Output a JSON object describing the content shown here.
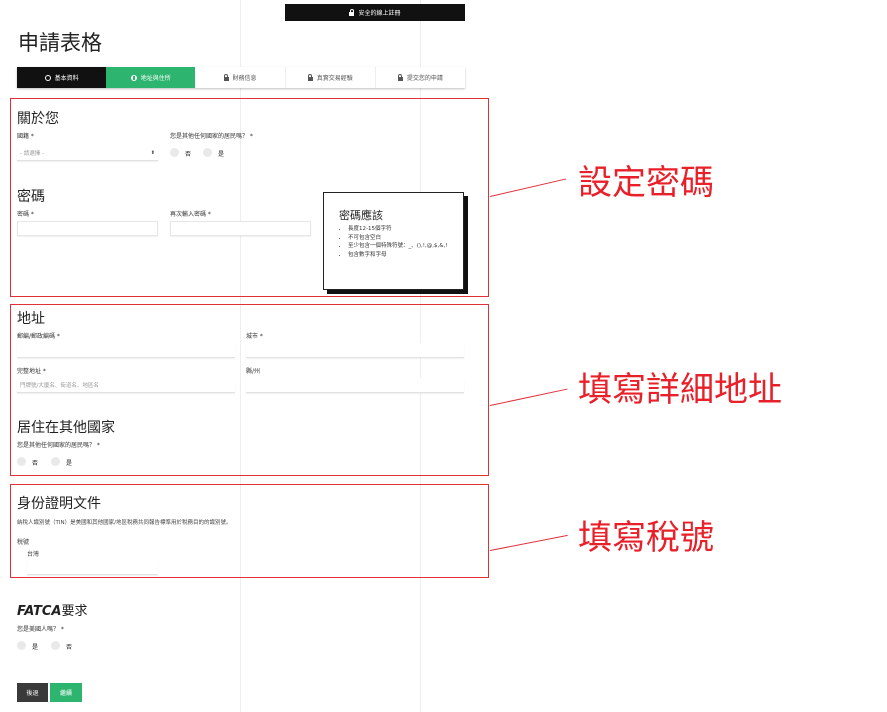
{
  "header": {
    "secure_label": "安全的線上註冊",
    "page_title": "申請表格"
  },
  "steps": [
    {
      "label": "基本資料",
      "state": "done",
      "icon": "check-circle-icon"
    },
    {
      "label": "地址與住所",
      "state": "active",
      "icon": "plus-circle-icon"
    },
    {
      "label": "財務信息",
      "state": "locked",
      "icon": "lock-icon"
    },
    {
      "label": "真實交易經驗",
      "state": "locked",
      "icon": "lock-icon"
    },
    {
      "label": "提交您的申請",
      "state": "locked",
      "icon": "lock-icon"
    }
  ],
  "about": {
    "title": "關於您",
    "nationality_label": "國籍 *",
    "nationality_placeholder": "- 請選擇 -",
    "other_citizen_label": "您是其他任何國家的居民嗎？ *",
    "no": "否",
    "yes": "是"
  },
  "password": {
    "title": "密碼",
    "password_label": "密碼 *",
    "confirm_label": "再次輸入密碼 *",
    "rules_title": "密碼應該",
    "rules": [
      "長度12-15個字符",
      "不可包含空白",
      "至少包含一個特殊符號：_、(),!,@,$,&,!",
      "包含數字和字母"
    ]
  },
  "address": {
    "title": "地址",
    "postcode_label": "郵編/郵政編碼 *",
    "city_label": "城市 *",
    "full_address_label": "完整地址 *",
    "full_address_placeholder": "門牌號/大廈名、街道名、地區名",
    "state_label": "縣/州"
  },
  "residency": {
    "title": "居住在其他國家",
    "question": "您是其他任何國家的居民嗎？ *",
    "no": "否",
    "yes": "是"
  },
  "identity": {
    "title": "身份證明文件",
    "desc": "納稅人識別號（TIN）是美國和其他國家/地區稅務共同報告標準用於稅務目的的識別號。",
    "tax_label": "稅號",
    "country": "台灣"
  },
  "fatca": {
    "title_bold": "FATCA",
    "title_rest": "要求",
    "question": "您是美國人嗎？ *",
    "yes": "是",
    "no": "否"
  },
  "buttons": {
    "back": "後退",
    "continue": "繼續"
  },
  "annotations": {
    "password": "設定密碼",
    "address": "填寫詳細地址",
    "tax": "填寫稅號"
  },
  "colors": {
    "accent_green": "#2db46e",
    "annotation_red": "#e8202a",
    "dark": "#111111"
  }
}
